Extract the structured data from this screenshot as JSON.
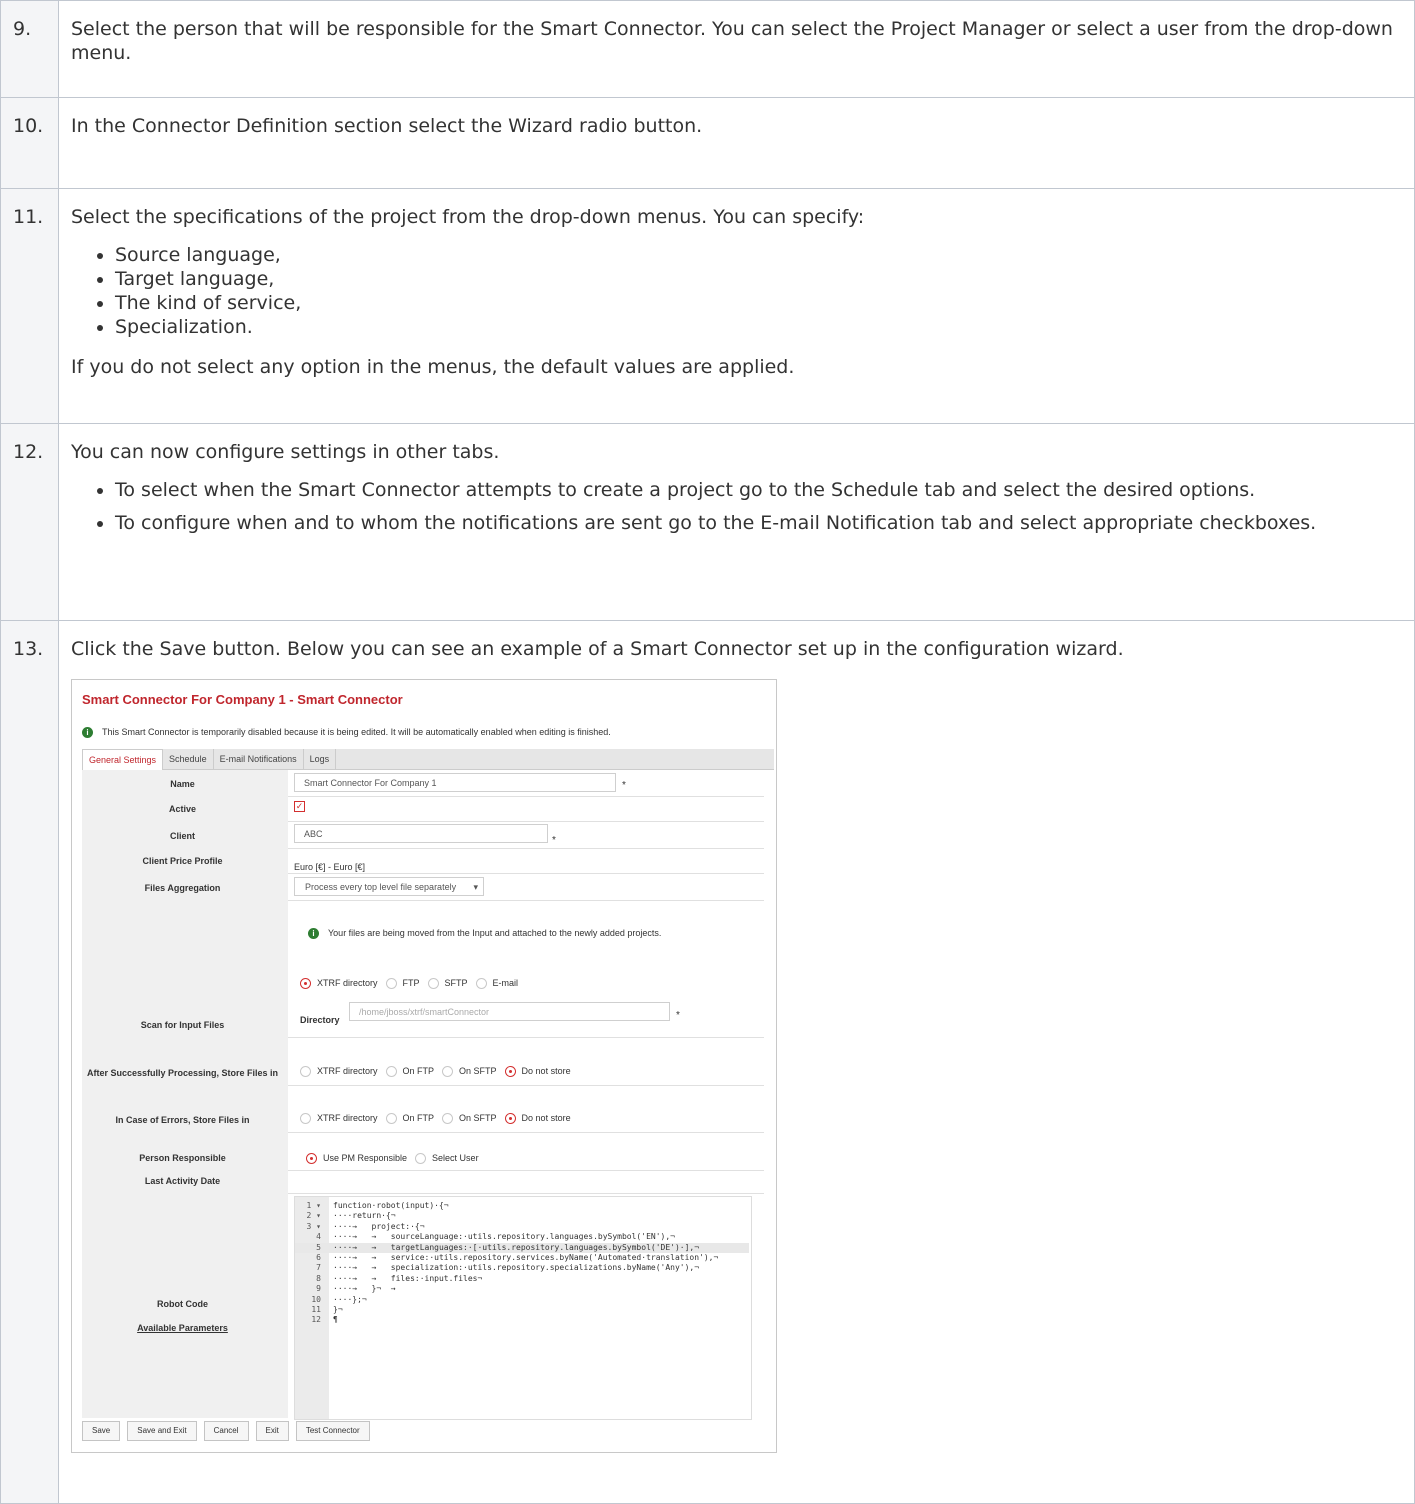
{
  "steps": [
    {
      "number": "9.",
      "text": "Select the person that will be responsible for the Smart Connector. You can select the Project Manager or select a user from the drop-down menu."
    },
    {
      "number": "10.",
      "text": "In the Connector Definition section select the Wizard radio button."
    },
    {
      "number": "11.",
      "text": "Select the specifications of the project from the drop-down menus. You can specify:",
      "items": [
        "Source language,",
        "Target language,",
        "The kind of service,",
        "Specialization."
      ],
      "after": "If you do not select any option in the menus, the default values are applied."
    },
    {
      "number": "12.",
      "text": "You can now configure settings in other tabs.",
      "items": [
        "To select when the Smart Connector attempts to create a project go to the Schedule tab and select the desired options.",
        "To configure when and to whom the notifications are sent go to the E-mail Notification tab and select appropriate checkboxes."
      ]
    },
    {
      "number": "13.",
      "text": "Click the Save button. Below you can see an example of a Smart Connector set up in the configuration wizard."
    }
  ],
  "screenshot": {
    "title": "Smart Connector For Company 1 - Smart Connector",
    "info": "This Smart Connector is temporarily disabled because it is being edited. It will be automatically enabled when editing is finished.",
    "tabs": [
      "General Settings",
      "Schedule",
      "E-mail Notifications",
      "Logs"
    ],
    "labels": {
      "name": "Name",
      "active": "Active",
      "client": "Client",
      "client_price_profile": "Client Price Profile",
      "files_aggregation": "Files Aggregation",
      "scan_for_input": "Scan for Input Files",
      "after_success": "After Successfully Processing, Store Files in",
      "in_case_errors": "In Case of Errors, Store Files in",
      "person_responsible": "Person Responsible",
      "last_activity": "Last Activity Date",
      "robot_code": "Robot Code",
      "available_parameters": "Available Parameters",
      "directory": "Directory"
    },
    "values": {
      "name": "Smart Connector For Company 1",
      "client": "ABC",
      "client_price_profile": "Euro [€] - Euro [€]",
      "files_aggregation": "Process every top level file separately",
      "scan_info": "Your files are being moved from the Input and attached to the newly added projects.",
      "directory_placeholder": "/home/jboss/xtrf/smartConnector",
      "required": "*",
      "check": "✓",
      "dropdown_arrow": "▾",
      "info_glyph": "i"
    },
    "radio_options": {
      "scan": [
        "XTRF directory",
        "FTP",
        "SFTP",
        "E-mail"
      ],
      "store": [
        "XTRF directory",
        "On FTP",
        "On SFTP",
        "Do not store"
      ],
      "errors": [
        "XTRF directory",
        "On FTP",
        "On SFTP",
        "Do not store"
      ],
      "person": [
        "Use PM Responsible",
        "Select User"
      ]
    },
    "code_lines": [
      {
        "n": "1 ▾",
        "t": "function·robot(input)·{¬"
      },
      {
        "n": "2 ▾",
        "t": "····return·{¬"
      },
      {
        "n": "3 ▾",
        "t": "····→   project:·{¬"
      },
      {
        "n": "4",
        "t": "····→   →   sourceLanguage:·utils.repository.languages.bySymbol('EN'),¬"
      },
      {
        "n": "5",
        "t": "····→   →   targetLanguages:·[·utils.repository.languages.bySymbol('DE')·],¬"
      },
      {
        "n": "6",
        "t": "····→   →   service:·utils.repository.services.byName('Automated·translation'),¬"
      },
      {
        "n": "7",
        "t": "····→   →   specialization:·utils.repository.specializations.byName('Any'),¬"
      },
      {
        "n": "8",
        "t": "····→   →   files:·input.files¬"
      },
      {
        "n": "9",
        "t": "····→   }¬  →"
      },
      {
        "n": "10",
        "t": "····};¬"
      },
      {
        "n": "11",
        "t": "}¬"
      },
      {
        "n": "12",
        "t": "¶"
      }
    ],
    "buttons": [
      "Save",
      "Save and Exit",
      "Cancel",
      "Exit",
      "Test Connector"
    ]
  }
}
